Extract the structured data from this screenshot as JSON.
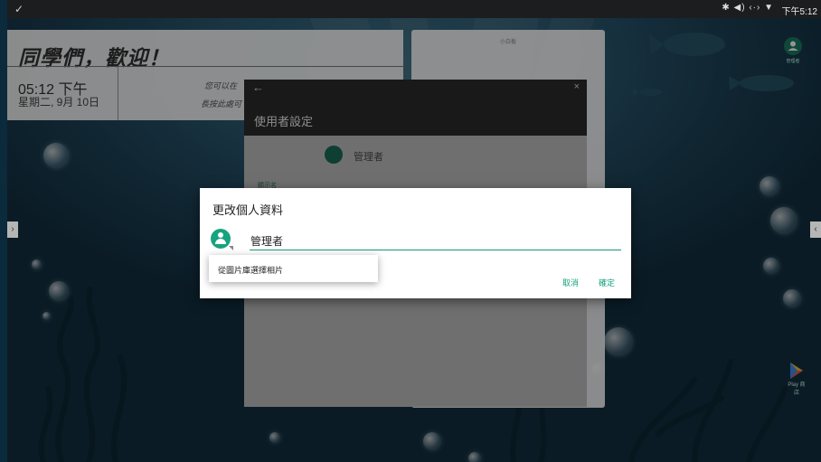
{
  "status_bar": {
    "check_icon": "✓",
    "status_icons": "✱ ◀) ‹·› ▼",
    "time": "下午5:12"
  },
  "welcome": {
    "title": "同學們，歡迎！",
    "time": "05:12 下午",
    "date": "星期二, 9月 10日",
    "hint_line1": "您可以在",
    "hint_line2": "長按此處可"
  },
  "note_panel": {
    "title": "小白板"
  },
  "user_settings": {
    "back_icon": "←",
    "close_icon": "×",
    "title": "使用者設定",
    "user_name": "管理者",
    "field_label": "顯示名"
  },
  "launcher": {
    "admin_label": "管理者",
    "play_store_label": "Play 商店"
  },
  "nav": {
    "left_arrow": "›",
    "right_arrow": "‹"
  },
  "dialog": {
    "title": "更改個人資料",
    "name_value": "管理者",
    "cancel": "取消",
    "ok": "確定",
    "menu_item": "從圖片庫選擇相片"
  },
  "colors": {
    "accent": "#17a37e",
    "dialog_header": "#2b2b2b"
  }
}
